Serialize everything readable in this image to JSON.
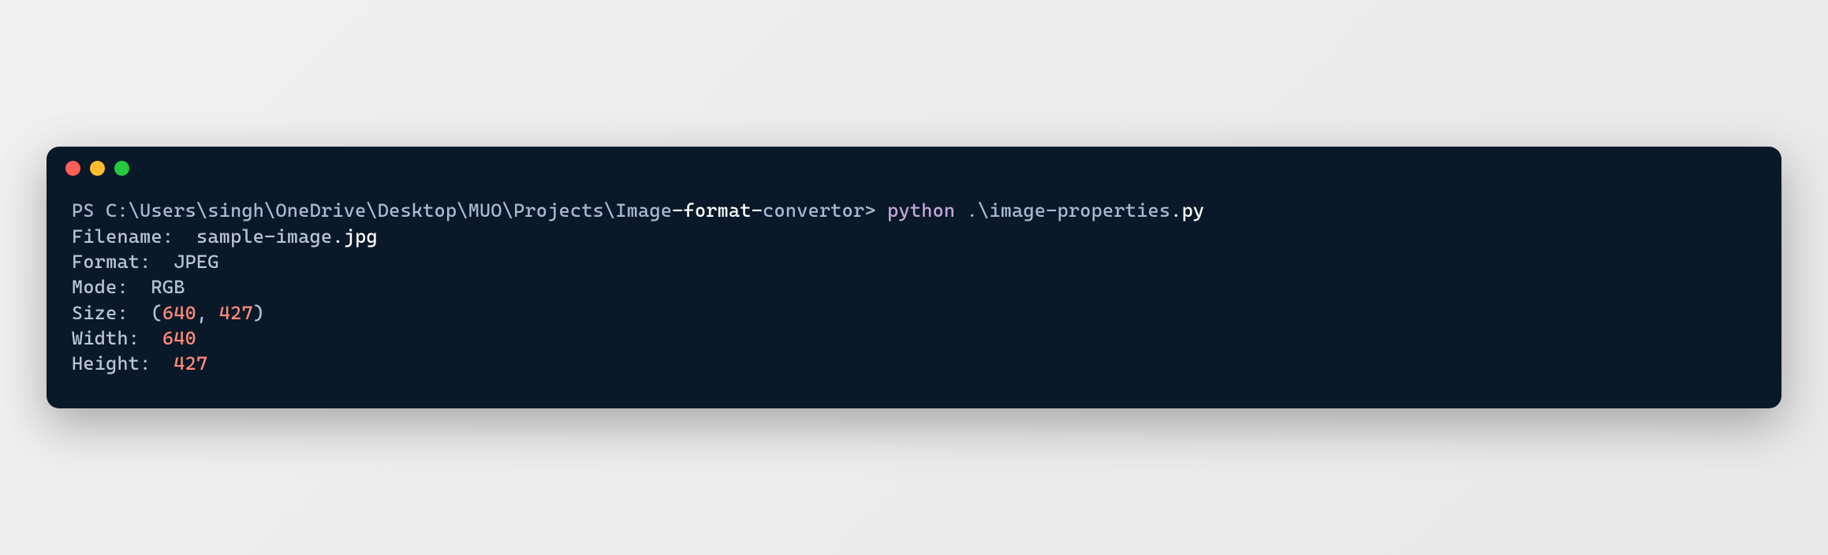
{
  "prompt": {
    "ps_prefix": "PS ",
    "path": "C:\\Users\\singh\\OneDrive\\Desktop\\MUO\\Projects\\Image",
    "path_suffix1": "-format-",
    "path_suffix2": "convertor",
    "prompt_char": "> ",
    "command": "python ",
    "arg_prefix": ".\\image-properties",
    "arg_suffix": ".py"
  },
  "output": {
    "filename_label": "Filename:  ",
    "filename_value": "sample-image",
    "filename_ext": ".jpg",
    "format_label": "Format:  ",
    "format_value": "JPEG",
    "mode_label": "Mode:  ",
    "mode_value": "RGB",
    "size_label": "Size:  ",
    "size_open": "(",
    "size_w": "640",
    "size_comma": ", ",
    "size_h": "427",
    "size_close": ")",
    "width_label": "Width:  ",
    "width_value": "640",
    "height_label": "Height:  ",
    "height_value": "427"
  }
}
